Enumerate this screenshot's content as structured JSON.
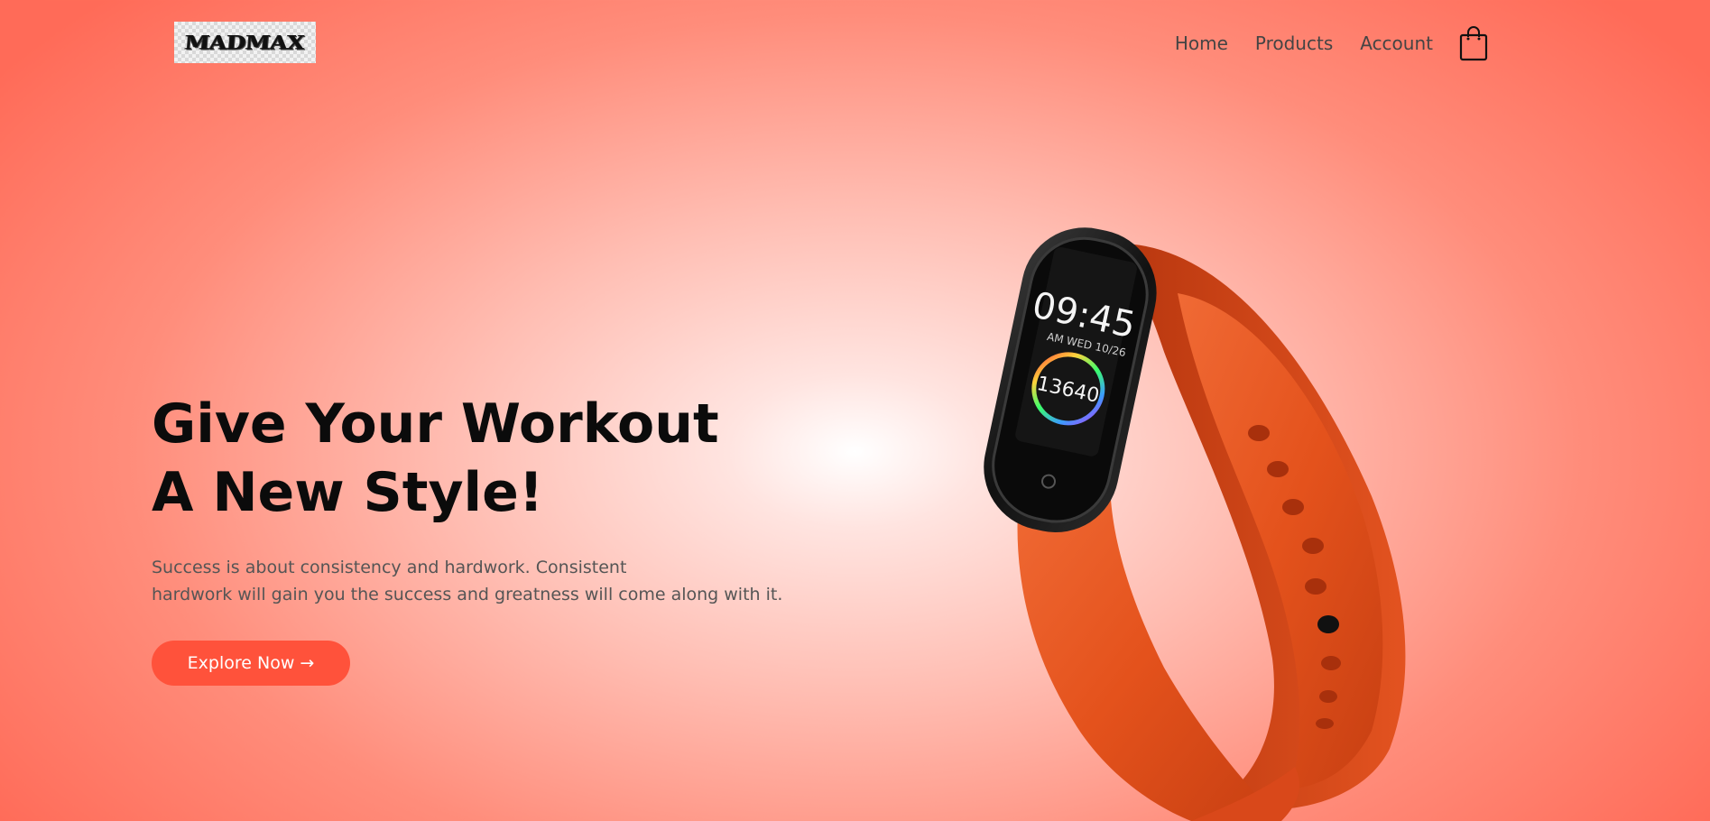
{
  "brand": {
    "logo_text": "MADMAX"
  },
  "nav": {
    "links": [
      {
        "label": "Home"
      },
      {
        "label": "Products"
      },
      {
        "label": "Account"
      }
    ],
    "cart_icon": "shopping-bag-icon"
  },
  "hero": {
    "headline_lines": [
      "Give Your Workout",
      "A New Style!"
    ],
    "description_lines": [
      "Success is about consistency and hardwork. Consistent",
      "hardwork will gain you the success and greatness will come along with it."
    ],
    "cta_label": "Explore Now →"
  },
  "product_image": {
    "time": "09:45",
    "am_pm": "AM",
    "date": "WED 10/26",
    "steps": "13640"
  },
  "colors": {
    "accent": "#ff523b",
    "band": "#e8541f",
    "background_edge": "#ff6b58",
    "background_center": "#ffffff"
  }
}
